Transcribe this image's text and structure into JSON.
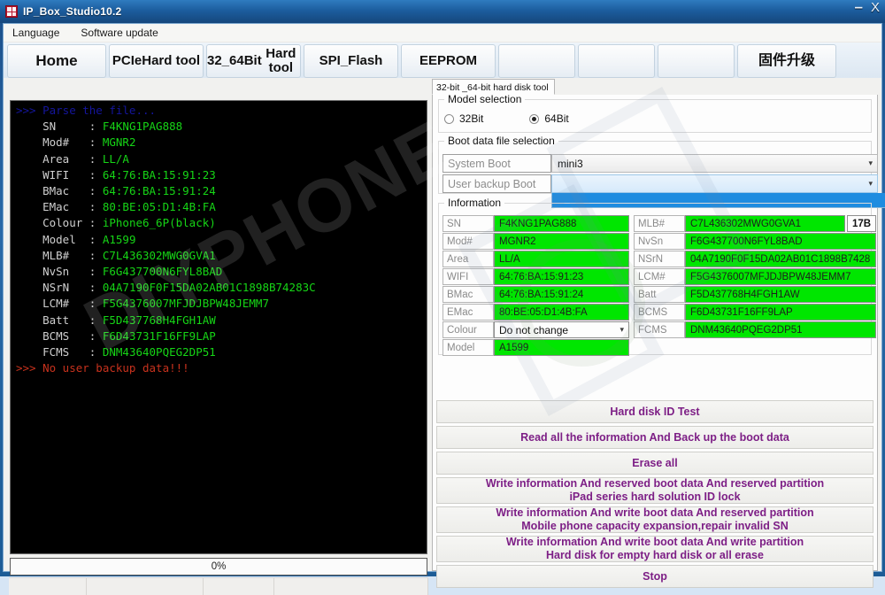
{
  "window": {
    "title": "IP_Box_Studio10.2",
    "app_icon": "app-logo-icon",
    "minimize_label": "–",
    "close_label": "X"
  },
  "menubar": {
    "items": [
      "Language",
      "Software update"
    ]
  },
  "tabs": [
    {
      "label": "Home",
      "size": "w-home"
    },
    {
      "label": "PCIe\nHard tool",
      "size": "w-pcie"
    },
    {
      "label": "32_64Bit\nHard tool",
      "size": "w-3264"
    },
    {
      "label": "SPI_Flash",
      "size": "w-spi"
    },
    {
      "label": "EEPROM",
      "size": "w-eep"
    },
    {
      "label": "",
      "size": "w-blank"
    },
    {
      "label": "",
      "size": "w-blank"
    },
    {
      "label": "",
      "size": "w-blank"
    },
    {
      "label": "固件升级",
      "size": "w-fw"
    }
  ],
  "console": {
    "header": ">>> Parse the file...",
    "rows": [
      {
        "key": "SN",
        "value": "F4KNG1PAG888"
      },
      {
        "key": "Mod#",
        "value": "MGNR2"
      },
      {
        "key": "Area",
        "value": "LL/A"
      },
      {
        "key": "WIFI",
        "value": "64:76:BA:15:91:23"
      },
      {
        "key": "BMac",
        "value": "64:76:BA:15:91:24"
      },
      {
        "key": "EMac",
        "value": "80:BE:05:D1:4B:FA"
      },
      {
        "key": "Colour",
        "value": "iPhone6_6P(black)"
      },
      {
        "key": "Model",
        "value": "A1599"
      },
      {
        "key": "MLB#",
        "value": "C7L436302MWG0GVA1"
      },
      {
        "key": "NvSn",
        "value": "F6G437700N6FYL8BAD"
      },
      {
        "key": "NSrN",
        "value": "04A7190F0F15DA02AB01C1898B74283C"
      },
      {
        "key": "LCM#",
        "value": "F5G4376007MFJDJBPW48JEMM7"
      },
      {
        "key": "Batt",
        "value": "F5D437768H4FGH1AW"
      },
      {
        "key": "BCMS",
        "value": "F6D43731F16FF9LAP"
      },
      {
        "key": "FCMS",
        "value": "DNM43640PQEG2DP51"
      }
    ],
    "error": ">>> No user backup data!!!"
  },
  "progress": {
    "label": "0%",
    "percent": 0
  },
  "statusbar": {
    "cells": [
      "",
      "",
      "",
      ""
    ]
  },
  "right_panel": {
    "tab_header": "32-bit _64-bit hard disk tool",
    "model_selection": {
      "legend": "Model selection",
      "options": [
        {
          "label": "32Bit",
          "checked": false
        },
        {
          "label": "64Bit",
          "checked": true
        }
      ]
    },
    "boot_selection": {
      "legend": "Boot data file selection",
      "rows": [
        {
          "label": "System Boot",
          "value": "mini3",
          "open": false
        },
        {
          "label": "User backup Boot",
          "value": "",
          "open": true
        }
      ],
      "dropdown_highlight_color": "#1e8ce0"
    },
    "information": {
      "legend": "Information",
      "left": [
        {
          "label": "SN",
          "value": "F4KNG1PAG888",
          "type": "text"
        },
        {
          "label": "Mod#",
          "value": "MGNR2",
          "type": "text"
        },
        {
          "label": "Area",
          "value": "LL/A",
          "type": "text"
        },
        {
          "label": "WIFI",
          "value": "64:76:BA:15:91:23",
          "type": "text"
        },
        {
          "label": "BMac",
          "value": "64:76:BA:15:91:24",
          "type": "text"
        },
        {
          "label": "EMac",
          "value": "80:BE:05:D1:4B:FA",
          "type": "text"
        },
        {
          "label": "Colour",
          "value": "Do not change",
          "type": "combo"
        },
        {
          "label": "Model",
          "value": "A1599",
          "type": "text"
        }
      ],
      "right": [
        {
          "label": "MLB#",
          "value": "C7L436302MWG0GVA1",
          "suffix": "17B"
        },
        {
          "label": "NvSn",
          "value": "F6G437700N6FYL8BAD"
        },
        {
          "label": "NSrN",
          "value": "04A7190F0F15DA02AB01C1898B7428"
        },
        {
          "label": "LCM#",
          "value": "F5G4376007MFJDJBPW48JEMM7"
        },
        {
          "label": "Batt",
          "value": "F5D437768H4FGH1AW"
        },
        {
          "label": "BCMS",
          "value": "F6D43731F16FF9LAP"
        },
        {
          "label": "FCMS",
          "value": "DNM43640PQEG2DP51"
        }
      ],
      "field_color": "#00e600"
    },
    "actions": [
      {
        "line1": "Hard disk ID Test",
        "line2": "",
        "h": "h1"
      },
      {
        "line1": "Read all the information And Back up the boot data",
        "line2": "",
        "h": "h1"
      },
      {
        "line1": "Erase all",
        "line2": "",
        "h": "h1"
      },
      {
        "line1": "Write information And reserved boot data And reserved partition",
        "line2": "iPad series hard solution ID lock",
        "h": "h2"
      },
      {
        "line1": "Write information And write boot data And reserved partition",
        "line2": "Mobile phone capacity expansion,repair invalid SN",
        "h": "h2"
      },
      {
        "line1": "Write information And write boot data And write partition",
        "line2": "Hard disk for empty hard disk or all erase",
        "h": "h2"
      },
      {
        "line1": "Stop",
        "line2": "",
        "h": "h1"
      }
    ],
    "action_color": "#7d1f86"
  },
  "watermark": {
    "text": "DIYPHONE"
  }
}
